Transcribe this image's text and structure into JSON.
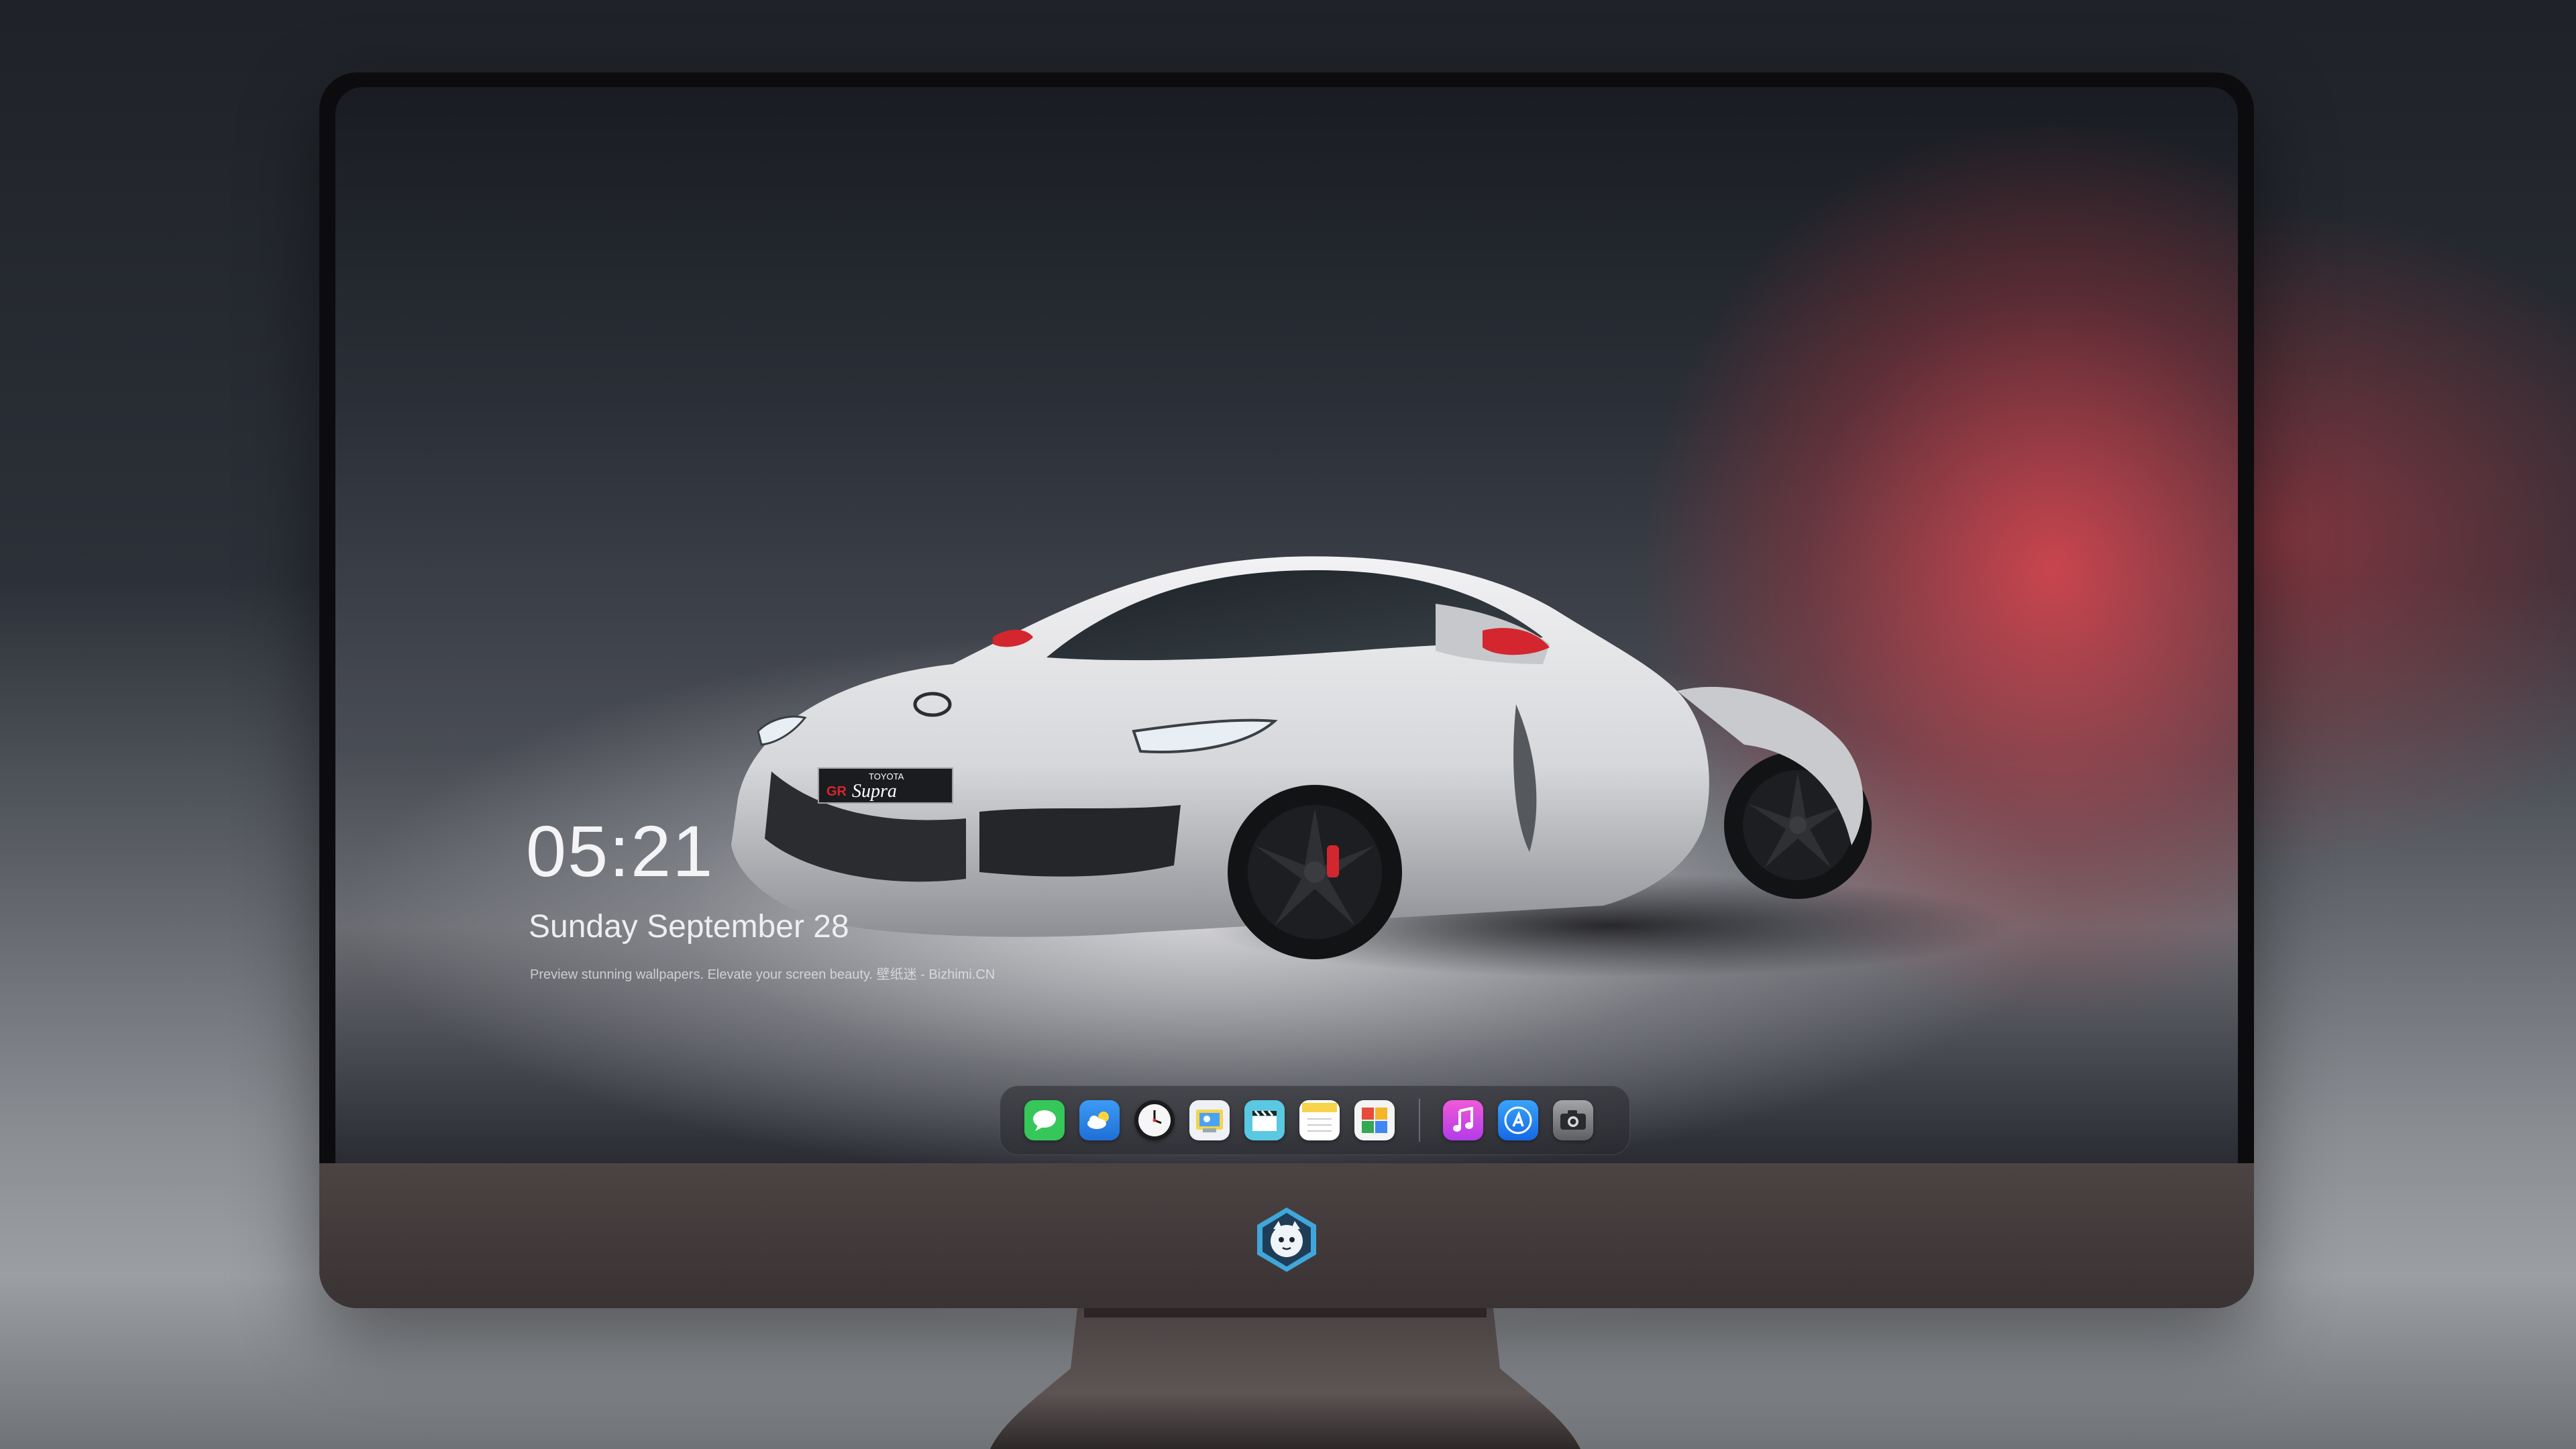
{
  "lock_screen": {
    "time": "05:21",
    "date": "Sunday September  28",
    "tagline": "Preview stunning wallpapers. Elevate your screen beauty. 壁纸迷 - Bizhimi.CN"
  },
  "wallpaper": {
    "car_badge_top": "TOYOTA",
    "car_badge_gr": "GR",
    "car_badge_model": "Supra",
    "accent_color": "#d94650"
  },
  "dock": {
    "apps": [
      {
        "name": "messages",
        "icon": "speech-bubble-icon",
        "color": "#35c759"
      },
      {
        "name": "weather",
        "icon": "cloud-sun-icon",
        "color": "#2d8cf0"
      },
      {
        "name": "clock",
        "icon": "clock-icon",
        "color": "#f4f4f4"
      },
      {
        "name": "preview",
        "icon": "photo-viewer-icon",
        "color": "#e9c84a"
      },
      {
        "name": "videos",
        "icon": "clapperboard-icon",
        "color": "#5ac8e0"
      },
      {
        "name": "notes",
        "icon": "notes-icon",
        "color": "#f7d44c"
      },
      {
        "name": "photo-booth",
        "icon": "photo-grid-icon",
        "color": "#f0f0f0"
      },
      {
        "name": "music",
        "icon": "music-note-icon",
        "color": "#e64ccf"
      },
      {
        "name": "app-store",
        "icon": "app-store-icon",
        "color": "#1e8ff5"
      },
      {
        "name": "camera",
        "icon": "camera-icon",
        "color": "#7a7a7e"
      }
    ]
  },
  "monitor": {
    "logo": "mascot-logo-icon"
  }
}
